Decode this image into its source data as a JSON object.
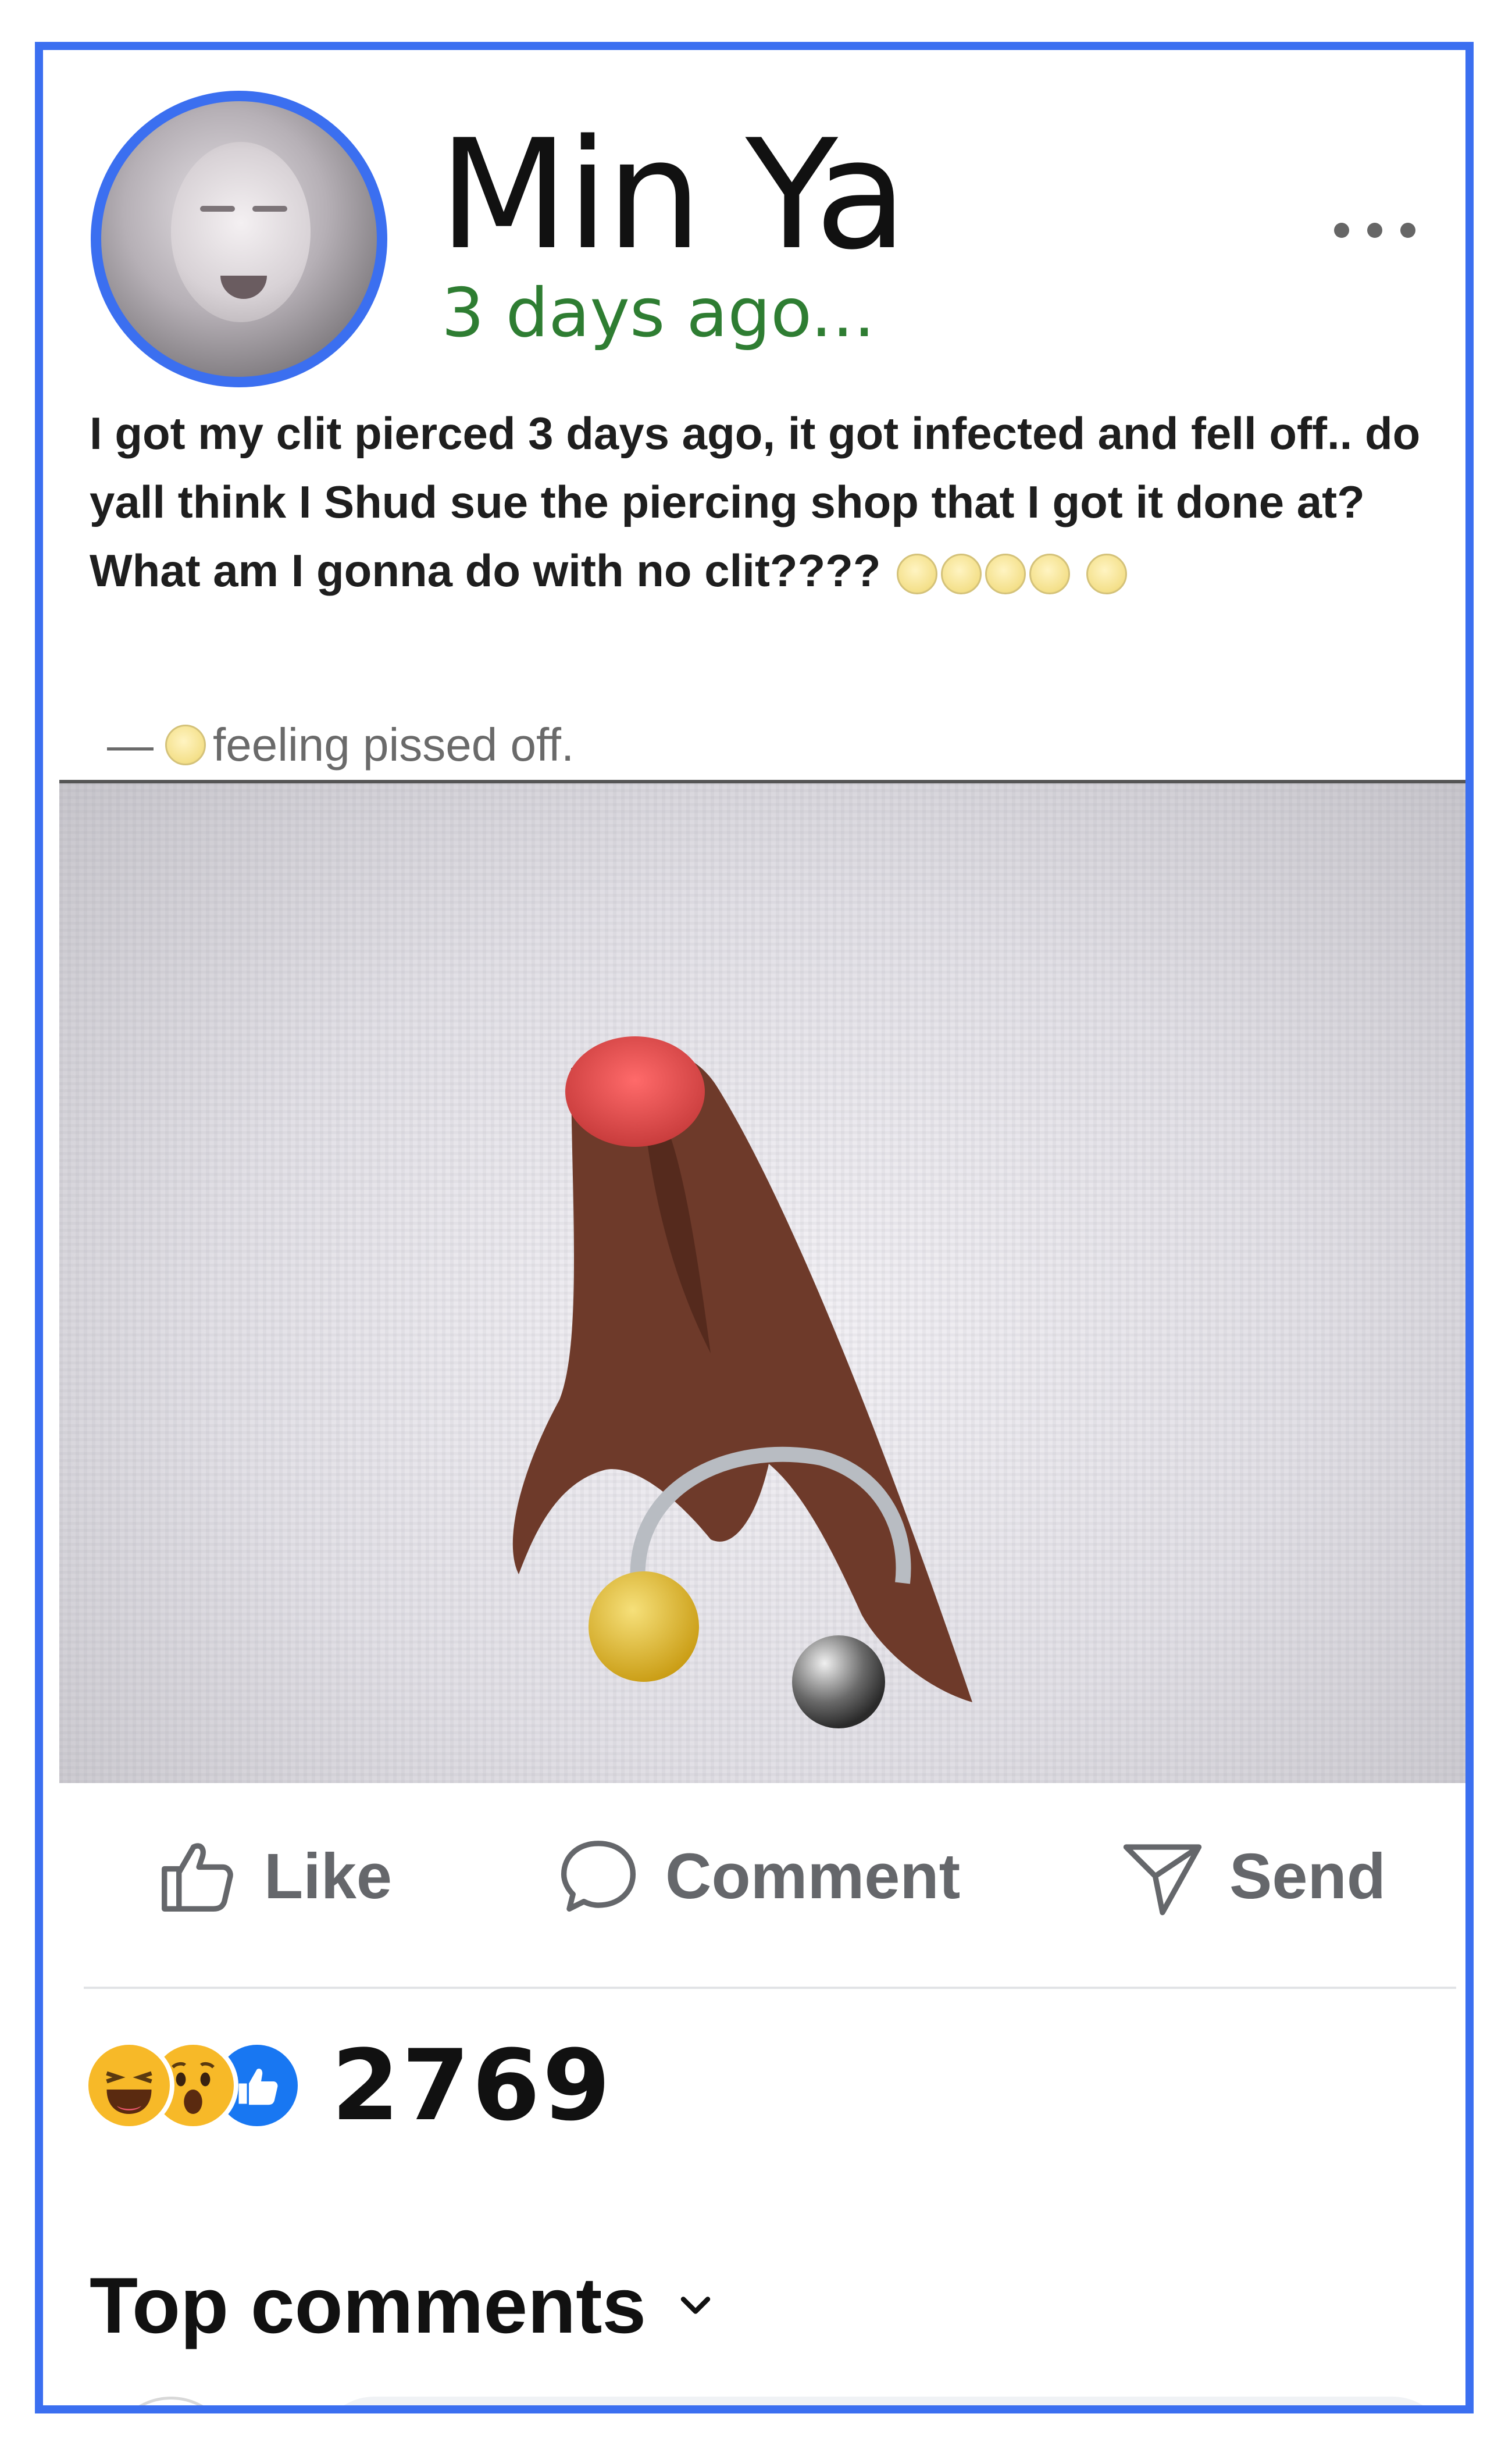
{
  "post": {
    "author": "Min Ya",
    "timestamp": "3 days ago...",
    "text": "I got my clit pierced 3 days ago, it got infected and fell off.. do yall think I Shud sue the piercing shop that I got it done at? What am I gonna do with no clit????",
    "feeling_prefix": "—",
    "feeling": "feeling pissed off.",
    "text_emojis": [
      "grimacing-emoji-icon",
      "grimacing-emoji-icon",
      "sad-emoji-icon",
      "sad-emoji-icon",
      "sad-emoji-icon"
    ],
    "feeling_emoji": "angry-emoji-icon"
  },
  "actions": {
    "like_label": "Like",
    "comment_label": "Comment",
    "send_label": "Send"
  },
  "reactions": {
    "types": [
      "haha-reaction-icon",
      "wow-reaction-icon",
      "like-reaction-icon"
    ],
    "count": "2769"
  },
  "comments": {
    "heading": "Top comments"
  },
  "colors": {
    "frame_border": "#3b6ff0",
    "timestamp": "#2e7d32",
    "action_text": "#65676b",
    "like_reaction": "#1877f2",
    "reaction_yellow": "#f7b928"
  }
}
